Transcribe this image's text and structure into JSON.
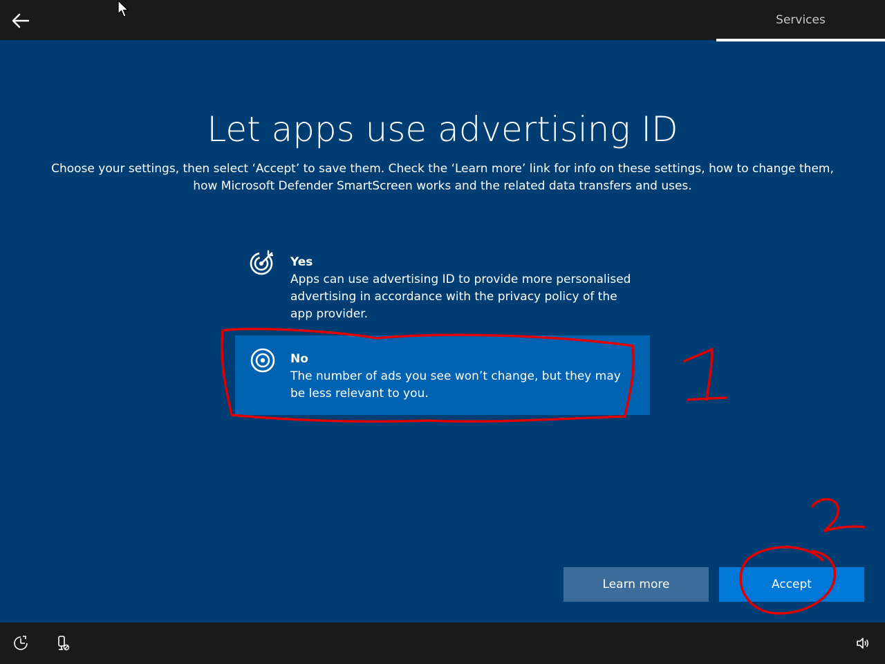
{
  "header": {
    "tab_label": "Services"
  },
  "main": {
    "title": "Let apps use advertising ID",
    "subtitle": "Choose your settings, then select ‘Accept’ to save them. Check the ‘Learn more’ link for info on these settings, how to change them, how Microsoft Defender SmartScreen works and the related data transfers and uses.",
    "options": [
      {
        "label": "Yes",
        "description": "Apps can use advertising ID to provide more personalised advertising in accordance with the privacy policy of the app provider.",
        "icon": "target-arrow-icon",
        "selected": false
      },
      {
        "label": "No",
        "description": "The number of ads you see won’t change, but they may be less relevant to you.",
        "icon": "target-icon",
        "selected": true
      }
    ]
  },
  "buttons": {
    "learn_more": "Learn more",
    "accept": "Accept"
  },
  "annotations": {
    "step1": "1",
    "step2": "2",
    "color": "#e00000"
  },
  "colors": {
    "background": "#003d73",
    "selected_option": "#0063b1",
    "accept_button": "#0078d7",
    "learn_more_button": "#3b6c9a",
    "bars": "#1a1a1a"
  }
}
